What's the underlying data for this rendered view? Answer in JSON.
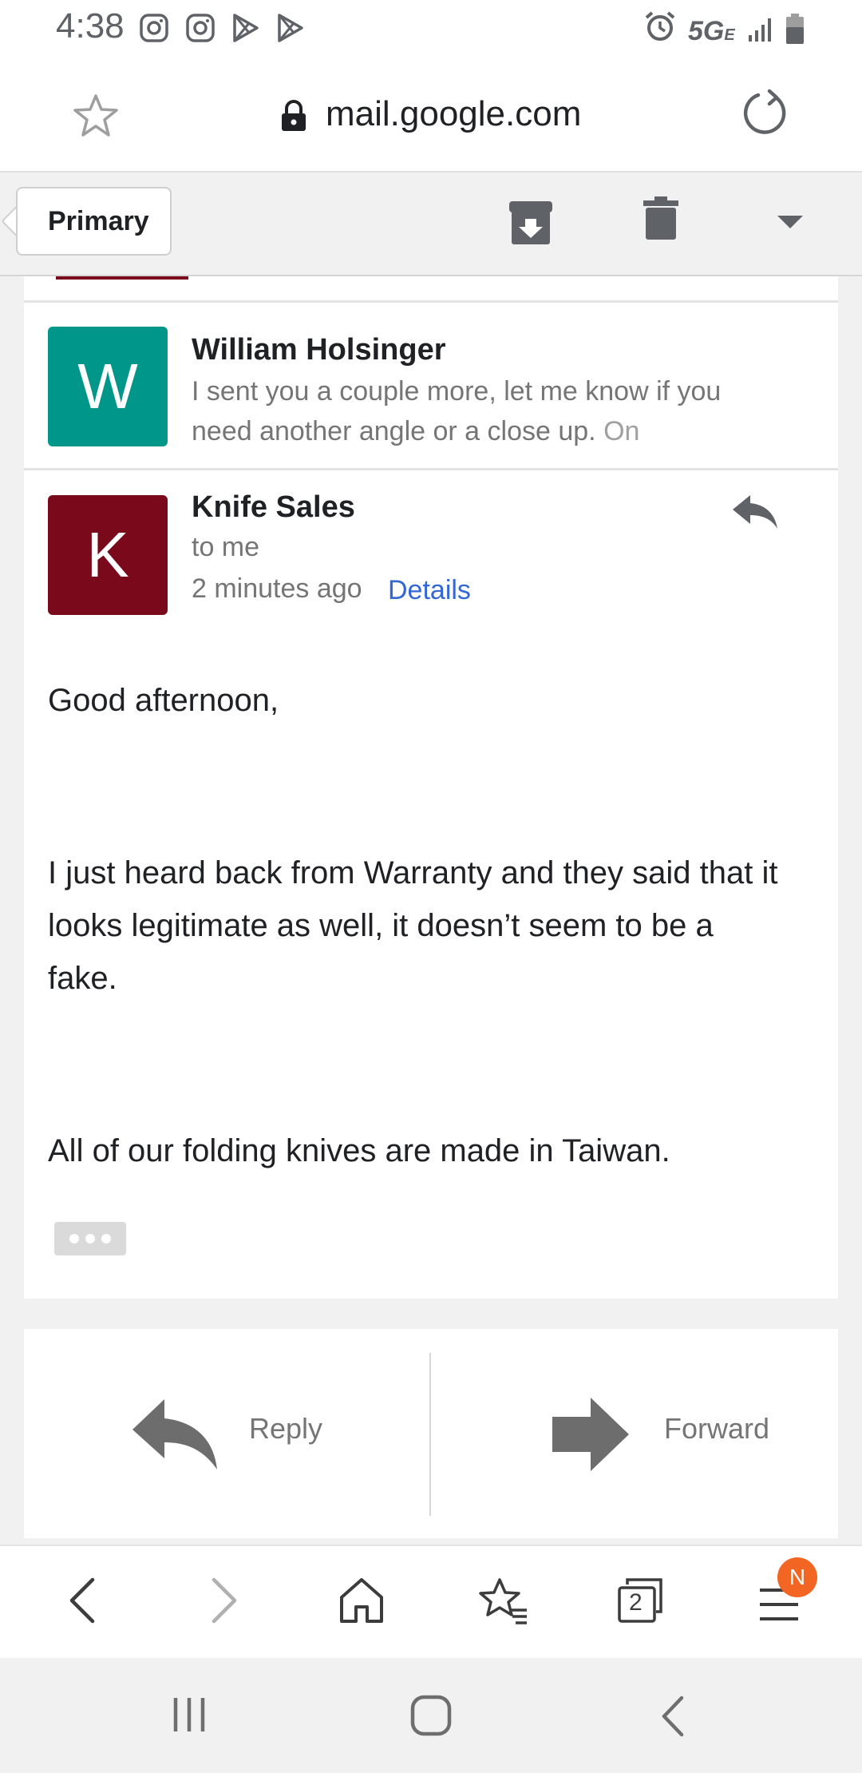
{
  "status_bar": {
    "time": "4:38",
    "network": "5G",
    "network_suffix": "E"
  },
  "url_bar": {
    "url": "mail.google.com"
  },
  "toolbar": {
    "primary_label": "Primary"
  },
  "thread": {
    "previous_message": {
      "avatar_letter": "W",
      "avatar_color": "#00968a",
      "sender": "William Holsinger",
      "snippet_line1": "I sent you a couple more, let me know if you",
      "snippet_line2": "need another angle or a close up.",
      "snippet_more": "On"
    },
    "open_message": {
      "avatar_letter": "K",
      "avatar_color": "#7a0a1b",
      "sender": "Knife Sales",
      "recipient": "to me",
      "time": "2 minutes ago",
      "details_label": "Details",
      "body": {
        "greeting": "Good afternoon,",
        "para1_line1": "I just heard back from Warranty and they said that it",
        "para1_line2": "looks legitimate as well, it doesn’t seem to be a",
        "para1_line3": "fake.",
        "para2": "All of our folding knives are made in Taiwan."
      }
    }
  },
  "actions": {
    "reply_label": "Reply",
    "forward_label": "Forward"
  },
  "browser_nav": {
    "tabs_count": "2",
    "menu_badge": "N"
  },
  "colors": {
    "accent_link": "#3367d6",
    "badge": "#f26522"
  }
}
